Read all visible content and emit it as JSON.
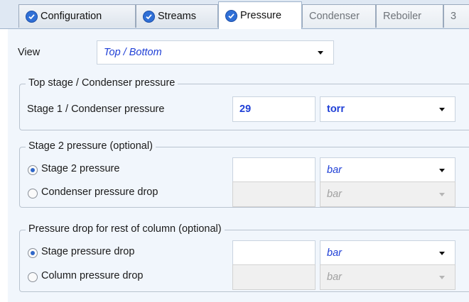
{
  "tabs": [
    {
      "label": "Configuration",
      "icon": "check-circle-icon"
    },
    {
      "label": "Streams",
      "icon": "check-circle-icon"
    },
    {
      "label": "Pressure",
      "icon": "check-circle-icon",
      "active": true
    },
    {
      "label": "Condenser",
      "disabled": true
    },
    {
      "label": "Reboiler",
      "disabled": true
    },
    {
      "label": "3",
      "disabled": true
    }
  ],
  "view": {
    "label": "View",
    "value": "Top / Bottom"
  },
  "top_stage": {
    "title": "Top stage / Condenser pressure",
    "field_label": "Stage 1 / Condenser pressure",
    "value": "29",
    "unit": "torr"
  },
  "stage2": {
    "title": "Stage 2 pressure (optional)",
    "options": [
      {
        "label": "Stage 2 pressure",
        "selected": true,
        "value": "",
        "unit": "bar",
        "enabled": true
      },
      {
        "label": "Condenser pressure drop",
        "selected": false,
        "value": "",
        "unit": "bar",
        "enabled": false
      }
    ]
  },
  "rest_of_column": {
    "title": "Pressure drop for rest of column (optional)",
    "options": [
      {
        "label": "Stage pressure drop",
        "selected": true,
        "value": "",
        "unit": "bar",
        "enabled": true
      },
      {
        "label": "Column pressure drop",
        "selected": false,
        "value": "",
        "unit": "bar",
        "enabled": false
      }
    ]
  },
  "colors": {
    "accent": "#2f6fd6",
    "value_blue": "#1f3fd6",
    "panel_bg": "#f1f6fc"
  }
}
